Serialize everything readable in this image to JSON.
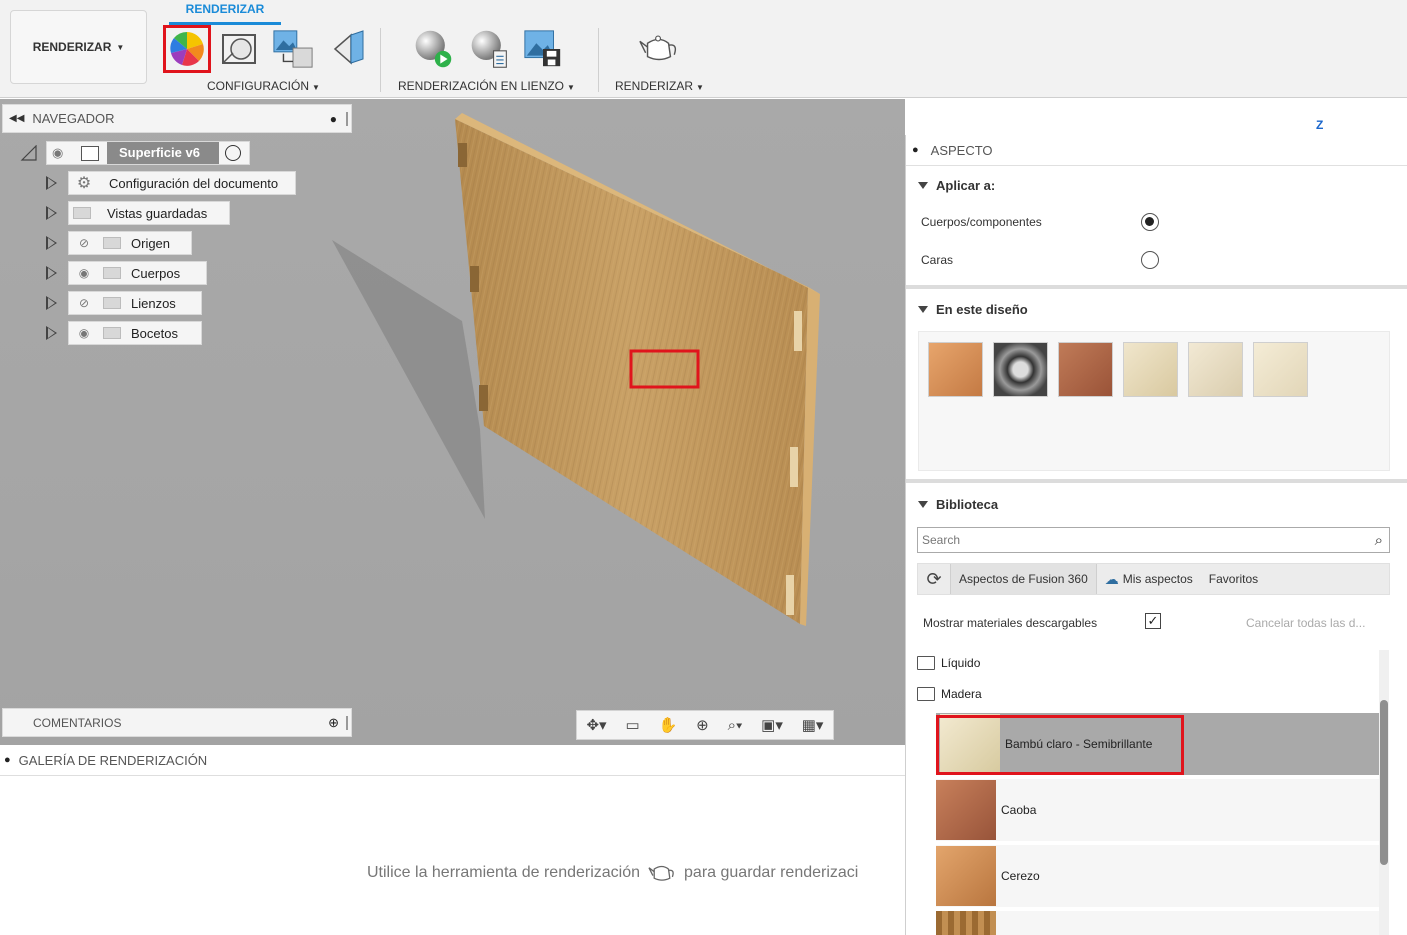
{
  "toolbar": {
    "workspace_label": "RENDERIZAR",
    "active_tab": "RENDERIZAR",
    "groups": {
      "setup": "CONFIGURACIÓN",
      "in_canvas": "RENDERIZACIÓN EN LIENZO",
      "render": "RENDERIZAR"
    }
  },
  "browser": {
    "title": "NAVEGADOR",
    "root": "Superficie v6",
    "items": [
      {
        "label": "Configuración del documento",
        "icon": "gear-icon"
      },
      {
        "label": "Vistas guardadas",
        "icon": "folder-icon"
      },
      {
        "label": "Origen",
        "icon": "folder-icon",
        "visibility": "hidden-eye-icon"
      },
      {
        "label": "Cuerpos",
        "icon": "folder-icon",
        "visibility": "eye-icon"
      },
      {
        "label": "Lienzos",
        "icon": "folder-icon",
        "visibility": "hidden-eye-icon"
      },
      {
        "label": "Bocetos",
        "icon": "folder-icon",
        "visibility": "eye-icon"
      }
    ]
  },
  "comments": {
    "title": "COMENTARIOS"
  },
  "gallery": {
    "title": "GALERÍA DE RENDERIZACIÓN",
    "hint_before": "Utilice la herramienta de renderización",
    "hint_after": "para guardar renderizaci"
  },
  "appearance": {
    "title": "ASPECTO",
    "apply_to": {
      "title": "Aplicar a:",
      "options": [
        {
          "label": "Cuerpos/componentes",
          "selected": true
        },
        {
          "label": "Caras",
          "selected": false
        }
      ]
    },
    "in_design": {
      "title": "En este diseño",
      "swatch_colors": [
        "#d9925a",
        "#5a5a5a",
        "#b06a4a",
        "#e8dcc0",
        "#eadfc8",
        "#efe6cf"
      ]
    },
    "library": {
      "title": "Biblioteca",
      "search_placeholder": "Search",
      "tabs": [
        "Aspectos de Fusion 360",
        "Mis aspectos",
        "Favoritos"
      ],
      "show_downloadable": "Mostrar materiales descargables",
      "show_downloadable_checked": true,
      "cancel_all": "Cancelar todas las d...",
      "folders": [
        "Líquido",
        "Madera"
      ],
      "materials": [
        {
          "label": "Bambú claro - Semibrillante",
          "color": "#e9dfc3",
          "selected": true
        },
        {
          "label": "Caoba",
          "color": "#b8704e",
          "selected": false
        },
        {
          "label": "Cerezo",
          "color": "#d08e5a",
          "selected": false
        }
      ]
    }
  },
  "colors": {
    "accent": "#1a8bd8",
    "highlight": "#e0141c",
    "viewport_bg": "#a6a6a6",
    "panel_wood": "#c9a166"
  }
}
